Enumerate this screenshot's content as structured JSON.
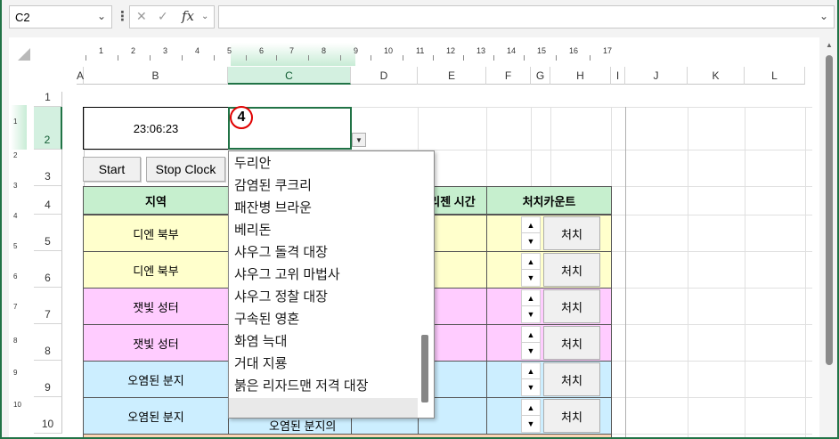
{
  "formula_bar": {
    "name_box": "C2",
    "cancel_icon": "✕",
    "enter_icon": "✓",
    "fx_label": "fx",
    "formula_value": ""
  },
  "ruler": {
    "numbers": [
      "1",
      "2",
      "3",
      "4",
      "5",
      "6",
      "7",
      "8",
      "9",
      "10",
      "11",
      "12",
      "13",
      "14",
      "15",
      "16",
      "17"
    ]
  },
  "columns": [
    "A",
    "B",
    "C",
    "D",
    "E",
    "F",
    "G",
    "H",
    "I",
    "J",
    "K",
    "L"
  ],
  "rows": [
    "1",
    "2",
    "3",
    "4",
    "5",
    "6",
    "7",
    "8",
    "9",
    "10"
  ],
  "vertical_ruler": [
    "1",
    "2",
    "3",
    "4",
    "5",
    "6",
    "7",
    "8",
    "9",
    "10"
  ],
  "sheet": {
    "clock": "23:06:23",
    "start_button": "Start",
    "stop_button": "Stop Clock",
    "header_region": "지역",
    "header_regen": "리젠 시간",
    "header_kill_count": "처치카운트",
    "regions": [
      "디엔 북부",
      "디엔 북부",
      "잿빛 성터",
      "잿빛 성터",
      "오염된 분지",
      "오염된 분지"
    ],
    "kill_button": "처치",
    "hidden_cell_fragment": "오염된 분지의"
  },
  "annotation": {
    "badge": "4"
  },
  "dropdown": {
    "items": [
      "두리안",
      "감염된 쿠크리",
      "패잔병 브라운",
      "베리돈",
      "샤우그 돌격 대장",
      "샤우그 고위 마법사",
      "샤우그 정찰 대장",
      "구속된 영혼",
      "화염 늑대",
      "거대 지룡",
      "붉은 리자드맨 저격 대장"
    ],
    "scroll_position": 0.74
  },
  "colors": {
    "accent": "#217346",
    "header_green": "#c6efce",
    "yellow": "#ffffcc",
    "pink": "#ffccff",
    "blue": "#cceeff",
    "salmon": "#fcd5b4",
    "badge_red": "#e00000"
  }
}
